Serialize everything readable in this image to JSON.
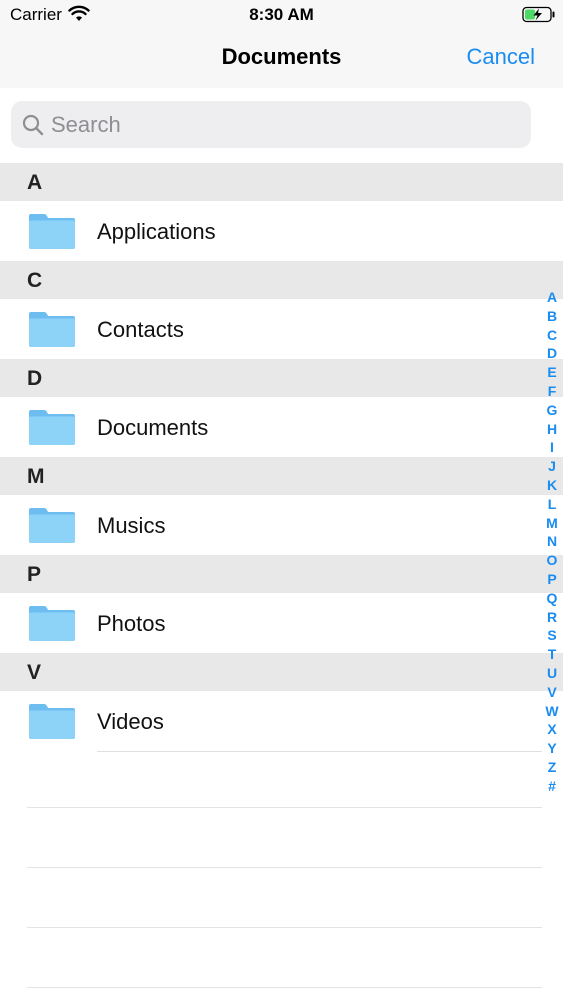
{
  "status_bar": {
    "carrier": "Carrier",
    "time": "8:30 AM"
  },
  "nav": {
    "title": "Documents",
    "cancel_label": "Cancel"
  },
  "search": {
    "placeholder": "Search",
    "value": ""
  },
  "sections": [
    {
      "letter": "A",
      "items": [
        {
          "label": "Applications",
          "icon": "folder-icon"
        }
      ]
    },
    {
      "letter": "C",
      "items": [
        {
          "label": "Contacts",
          "icon": "folder-icon"
        }
      ]
    },
    {
      "letter": "D",
      "items": [
        {
          "label": "Documents",
          "icon": "folder-icon"
        }
      ]
    },
    {
      "letter": "M",
      "items": [
        {
          "label": "Musics",
          "icon": "folder-icon"
        }
      ]
    },
    {
      "letter": "P",
      "items": [
        {
          "label": "Photos",
          "icon": "folder-icon"
        }
      ]
    },
    {
      "letter": "V",
      "items": [
        {
          "label": "Videos",
          "icon": "folder-icon"
        }
      ]
    }
  ],
  "index_letters": [
    "A",
    "B",
    "C",
    "D",
    "E",
    "F",
    "G",
    "H",
    "I",
    "J",
    "K",
    "L",
    "M",
    "N",
    "O",
    "P",
    "Q",
    "R",
    "S",
    "T",
    "U",
    "V",
    "W",
    "X",
    "Y",
    "Z",
    "#"
  ],
  "colors": {
    "accent": "#1a8cf0",
    "folder": "#7cc8f5",
    "section_header_bg": "#e8e8e9",
    "bar_bg": "#f7f7f7",
    "battery_fill": "#4cd964"
  }
}
